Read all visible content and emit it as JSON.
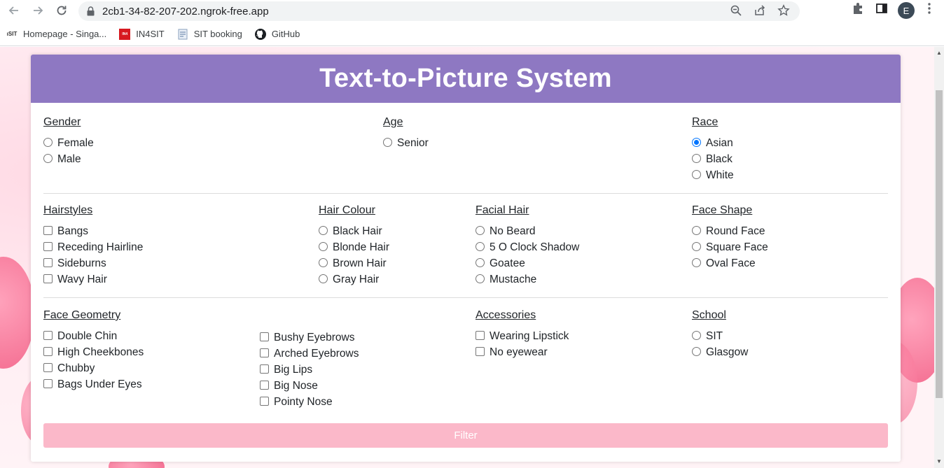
{
  "browser": {
    "url": "2cb1-34-82-207-202.ngrok-free.app",
    "profile_initial": "E",
    "bookmarks": [
      {
        "label": "Homepage - Singa...",
        "icon": "sit-logo-icon"
      },
      {
        "label": "IN4SIT",
        "icon": "in4sit-icon"
      },
      {
        "label": "SIT booking",
        "icon": "document-icon"
      },
      {
        "label": "GitHub",
        "icon": "github-icon"
      }
    ]
  },
  "page": {
    "title": "Text-to-Picture System",
    "filter_label": "Filter"
  },
  "sections": {
    "gender": {
      "title": "Gender",
      "options": [
        "Female",
        "Male"
      ]
    },
    "age": {
      "title": "Age",
      "options": [
        "Senior"
      ]
    },
    "race": {
      "title": "Race",
      "options": [
        "Asian",
        "Black",
        "White"
      ],
      "selected": "Asian"
    },
    "hairstyles": {
      "title": "Hairstyles",
      "options": [
        "Bangs",
        "Receding Hairline",
        "Sideburns",
        "Wavy Hair"
      ]
    },
    "hair_colour": {
      "title": "Hair Colour",
      "options": [
        "Black Hair",
        "Blonde Hair",
        "Brown Hair",
        "Gray Hair"
      ]
    },
    "facial_hair": {
      "title": "Facial Hair",
      "options": [
        "No Beard",
        "5 O Clock Shadow",
        "Goatee",
        "Mustache"
      ]
    },
    "face_shape": {
      "title": "Face Shape",
      "options": [
        "Round Face",
        "Square Face",
        "Oval Face"
      ]
    },
    "face_geometry": {
      "title": "Face Geometry",
      "options_col1": [
        "Double Chin",
        "High Cheekbones",
        "Chubby",
        "Bags Under Eyes"
      ],
      "options_col2": [
        "Bushy Eyebrows",
        "Arched Eyebrows",
        "Big Lips",
        "Big Nose",
        "Pointy Nose"
      ]
    },
    "accessories": {
      "title": "Accessories",
      "options": [
        "Wearing Lipstick",
        "No eyewear"
      ]
    },
    "school": {
      "title": "School",
      "options": [
        "SIT",
        "Glasgow"
      ]
    }
  },
  "colors": {
    "header": "#8e78c2",
    "filter_button": "#fbb8c9",
    "radio_selected": "#0075ff"
  }
}
